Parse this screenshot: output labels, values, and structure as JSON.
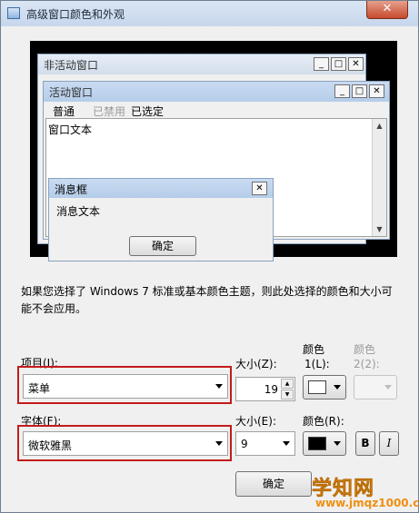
{
  "window": {
    "title": "高级窗口颜色和外观",
    "close_glyph": "✕"
  },
  "preview": {
    "inactive_window": {
      "title": "非活动窗口"
    },
    "active_window": {
      "title": "活动窗口",
      "menu": [
        "普通",
        "已禁用",
        "已选定"
      ],
      "client_text": "窗口文本"
    },
    "message_box": {
      "title": "消息框",
      "text": "消息文本",
      "ok_label": "确定"
    },
    "caption_buttons": {
      "minimize": "_",
      "maximize": "□",
      "close": "✕"
    }
  },
  "description": "如果您选择了 Windows 7 标准或基本颜色主题，则此处选择的颜色和大小可能不会应用。",
  "item": {
    "label": "项目(I):",
    "value": "菜单"
  },
  "size1": {
    "label": "大小(Z):",
    "value": "19"
  },
  "color1": {
    "label_line1": "颜色",
    "label_line2": "1(L):",
    "swatch": "#ffffff"
  },
  "color2": {
    "label_line1": "颜色",
    "label_line2": "2(2):"
  },
  "font": {
    "label": "字体(F):",
    "value": "微软雅黑"
  },
  "size2": {
    "label": "大小(E):",
    "value": "9"
  },
  "font_color": {
    "label": "颜色(R):",
    "swatch": "#000000"
  },
  "bold_label": "B",
  "italic_label": "I",
  "ok_button": "确定",
  "watermark": {
    "title": "学知网",
    "url": "www.jmqz1000.com"
  },
  "colors": {
    "highlight_box": "#c41b1b",
    "titlebar": "#c6d6ec"
  }
}
